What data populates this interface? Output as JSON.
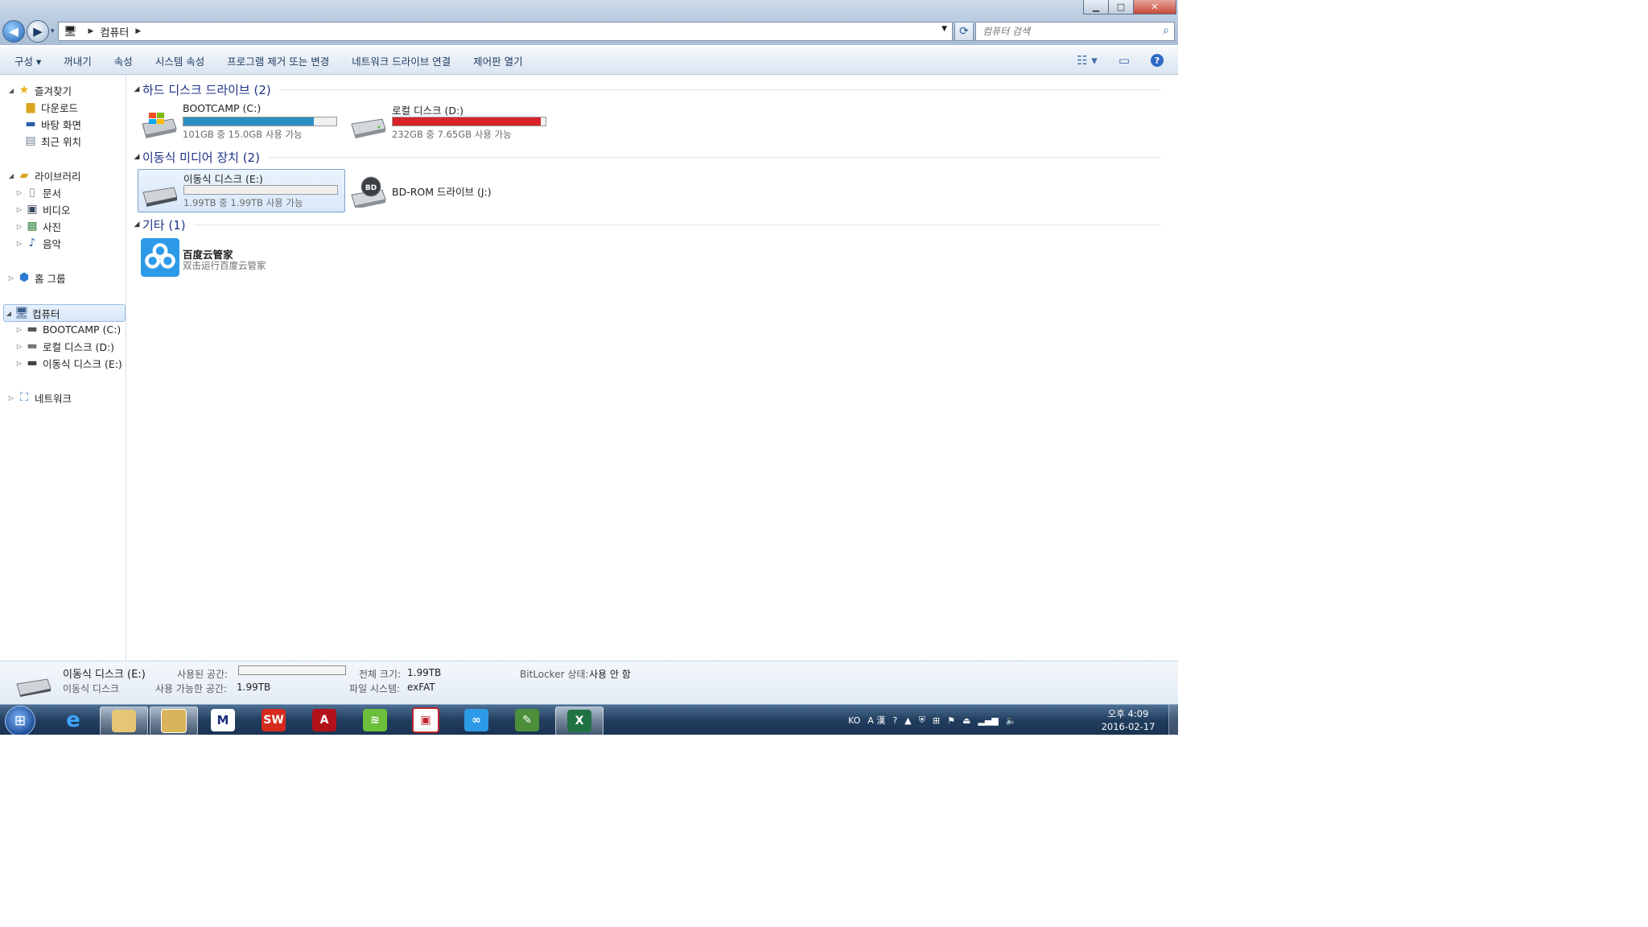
{
  "window": {
    "address": {
      "path_root": "컴퓨터"
    },
    "search": {
      "placeholder": "컴퓨터 검색"
    }
  },
  "toolbar": {
    "items": [
      "구성",
      "꺼내기",
      "속성",
      "시스템 속성",
      "프로그램 제거 또는 변경",
      "네트워크 드라이브 연결",
      "제어판 열기"
    ],
    "organize_arrow": "▾"
  },
  "nav": {
    "favorites": "즐겨찾기",
    "downloads": "다운로드",
    "desktop": "바탕 화면",
    "recent": "최근 위치",
    "libraries": "라이브러리",
    "documents": "문서",
    "videos": "비디오",
    "pictures": "사진",
    "music": "음악",
    "homegroup": "홈 그룹",
    "computer": "컴퓨터",
    "drive_c": "BOOTCAMP (C:)",
    "drive_d": "로컬 디스크 (D:)",
    "drive_e": "이동식 디스크 (E:)",
    "network": "네트워크"
  },
  "groups": {
    "hdd": "하드 디스크 드라이브 (2)",
    "removable": "이동식 미디어 장치 (2)",
    "other": "기타 (1)"
  },
  "drives": {
    "c": {
      "name": "BOOTCAMP (C:)",
      "sub": "101GB 중 15.0GB 사용 가능",
      "used_fraction": 0.85,
      "color": "#2a8fc4"
    },
    "d": {
      "name": "로컬 디스크 (D:)",
      "sub": "232GB 중 7.65GB 사용 가능",
      "used_fraction": 0.97,
      "color": "#d9232a"
    },
    "e": {
      "name": "이동식 디스크 (E:)",
      "sub": "1.99TB 중 1.99TB 사용 가능",
      "used_fraction": 0.0,
      "color": "#2a8fc4"
    },
    "j": {
      "name": "BD-ROM 드라이브 (J:)",
      "icon_text": "BD"
    },
    "baidu": {
      "name": "百度云管家",
      "sub": "双击运行百度云管家"
    }
  },
  "details": {
    "title": "이동식 디스크 (E:)",
    "subtitle": "이동식 디스크",
    "used_label": "사용된 공간:",
    "free_label": "사용 가능한 공간:",
    "free_value": "1.99TB",
    "total_label": "전체 크기:",
    "total_value": "1.99TB",
    "fs_label": "파일 시스템:",
    "fs_value": "exFAT",
    "bitlocker_label": "BitLocker 상태:",
    "bitlocker_value": "사용 안 함"
  },
  "taskbar": {
    "lang": "KO",
    "clock_time": "오후 4:09",
    "clock_date": "2016-02-17",
    "apps": [
      "internet-explorer-icon",
      "explorer-folder-icon",
      "explorer-window-icon",
      "yueming-icon",
      "solidworks-icon",
      "acrobat-icon",
      "evernote-like-icon",
      "red-app-icon",
      "baidu-cloud-icon",
      "evernote-icon",
      "excel-icon"
    ]
  }
}
